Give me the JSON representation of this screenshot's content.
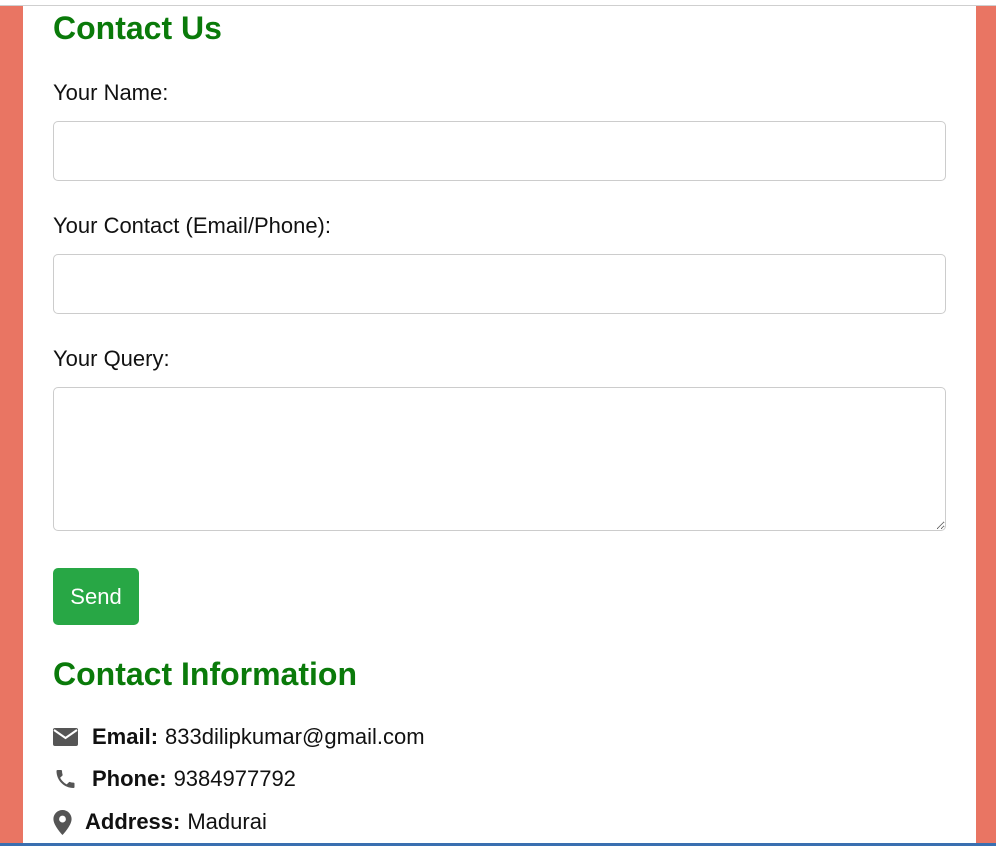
{
  "form": {
    "title": "Contact Us",
    "name_label": "Your Name:",
    "name_value": "",
    "contact_label": "Your Contact (Email/Phone):",
    "contact_value": "",
    "query_label": "Your Query:",
    "query_value": "",
    "send_label": "Send"
  },
  "info": {
    "title": "Contact Information",
    "items": [
      {
        "icon": "envelope-icon",
        "label": "Email:",
        "value": "833dilipkumar@gmail.com"
      },
      {
        "icon": "phone-icon",
        "label": "Phone:",
        "value": "9384977792"
      },
      {
        "icon": "map-marker-icon",
        "label": "Address:",
        "value": "Madurai"
      }
    ]
  },
  "colors": {
    "page_background": "#e97563",
    "heading": "#0a7a0a",
    "send_button": "#28a745",
    "icon": "#555555"
  }
}
